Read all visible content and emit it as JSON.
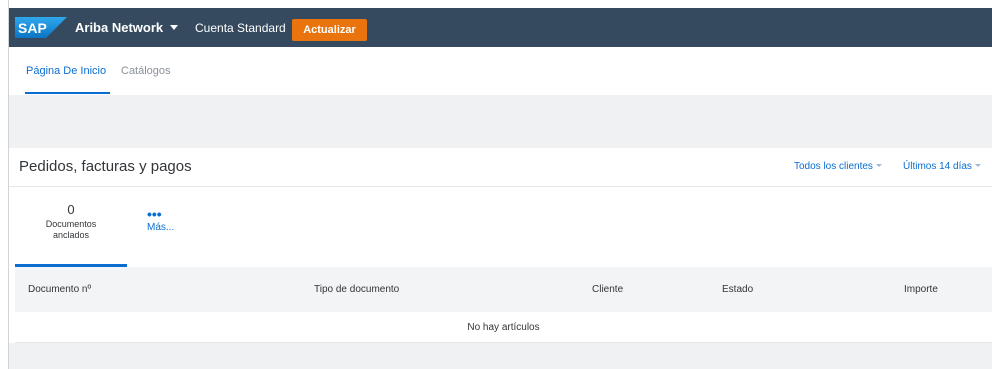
{
  "shell": {
    "logo_text": "SAP",
    "product_name": "Ariba Network",
    "account_type": "Cuenta Standard",
    "upgrade_label": "Actualizar",
    "colors": {
      "shell_bg": "#354a5f",
      "upgrade_bg": "#e9730c",
      "logo_blue": "#1a8ed8"
    }
  },
  "tabs": [
    {
      "label": "Página De Inicio",
      "active": true
    },
    {
      "label": "Catálogos",
      "active": false
    }
  ],
  "panel": {
    "title": "Pedidos, facturas y pagos",
    "filters": {
      "clients": "Todos los clientes",
      "period": "Últimos 14 días"
    },
    "tiles": {
      "pinned_count": "0",
      "pinned_label_line1": "Documentos",
      "pinned_label_line2": "anclados",
      "more_label": "Más..."
    },
    "table": {
      "columns": [
        "Documento nº",
        "Tipo de documento",
        "Cliente",
        "Estado",
        "Importe"
      ],
      "empty_message": "No hay artículos"
    }
  },
  "colors": {
    "accent": "#0a6ed1",
    "muted_tab": "#89919a",
    "background_band": "#eff1f3"
  }
}
